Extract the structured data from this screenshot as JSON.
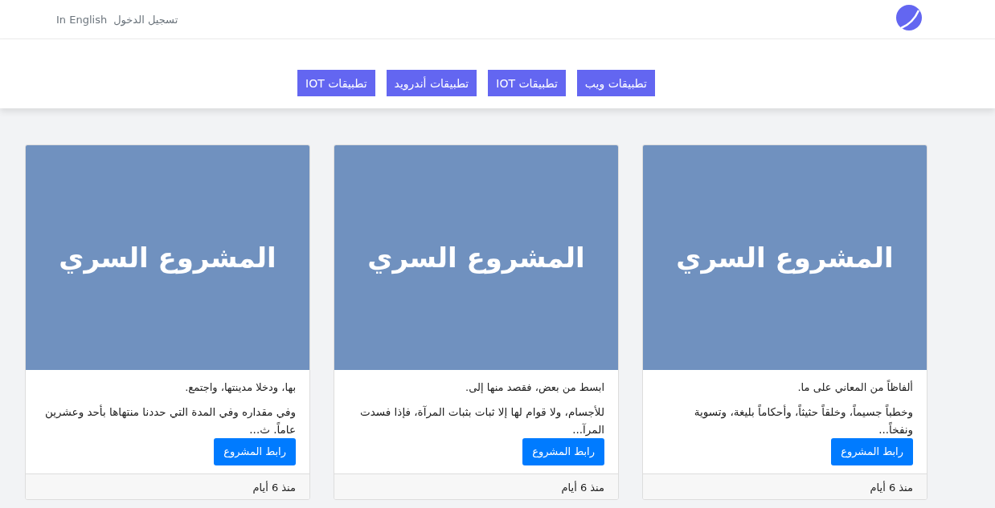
{
  "header": {
    "links": [
      "تسجيل الدخول",
      "In English"
    ]
  },
  "categories": [
    {
      "label": "تطبيقات ويب"
    },
    {
      "label": "تطبيقات IOT"
    },
    {
      "label": "تطبيقات أندرويد"
    },
    {
      "label": "تطبيقات IOT"
    }
  ],
  "projects": [
    {
      "image_title": "المشروع السري",
      "summary": "ألفاظاً من المعاني على ما.",
      "excerpt": "وخطباً جسيماً، وخلقاً حثيثاً، وأحكاماً بليغة، وتسوية ونفخاً...",
      "button": "رابط المشروع",
      "date": "منذ 6 أيام"
    },
    {
      "image_title": "المشروع السري",
      "summary": "ابسط من بعض، فقصد منها إلى.",
      "excerpt": "للأجسام، ولا قوام لها إلا ثبات بثبات المرآة، فإذا فسدت المرآ...",
      "button": "رابط المشروع",
      "date": "منذ 6 أيام"
    },
    {
      "image_title": "المشروع السري",
      "summary": "بها، ودخلا مدينتها، واجتمع.",
      "excerpt": "وفي مقداره وفي المدة التي حددنا منتهاها بأحد وعشرين عاماً. ث...",
      "button": "رابط المشروع",
      "date": "منذ 6 أيام"
    }
  ]
}
